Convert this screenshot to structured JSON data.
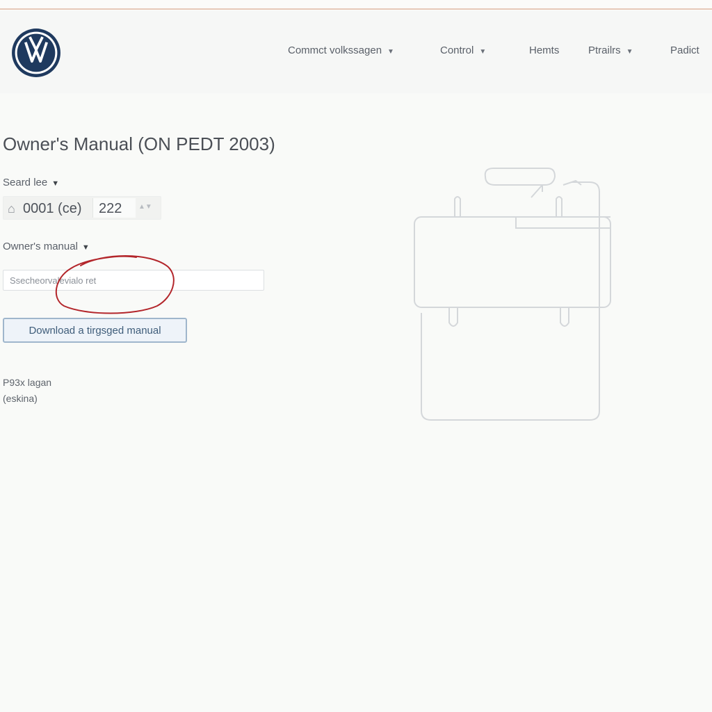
{
  "header": {
    "logo": "volkswagen-logo",
    "nav": [
      {
        "label": "Commct volkssagen",
        "has_dropdown": true
      },
      {
        "label": "Control",
        "has_dropdown": true
      },
      {
        "label": "Hemts",
        "has_dropdown": false
      },
      {
        "label": "Ptrailrs",
        "has_dropdown": true
      },
      {
        "label": "Padict",
        "has_dropdown": false
      }
    ]
  },
  "main": {
    "title": "Owner's Manual (ON PEDT 2003)",
    "year_label": "Seard lee",
    "year_select": {
      "icon": "home-icon",
      "code": "0001 (ce)",
      "value": "222"
    },
    "manual_label": "Owner's manual",
    "search": {
      "placeholder": "Ssecheorvalevialo ret",
      "value": ""
    },
    "download_label": "Download a tirgsged manual",
    "footer_line1": "P93x lagan",
    "footer_line2": "(eskina)"
  },
  "colors": {
    "accent": "#9fb6cc",
    "annotation": "#b3262b",
    "header_border": "#e7c9b8"
  },
  "illustration": "manual-booklet-outline"
}
